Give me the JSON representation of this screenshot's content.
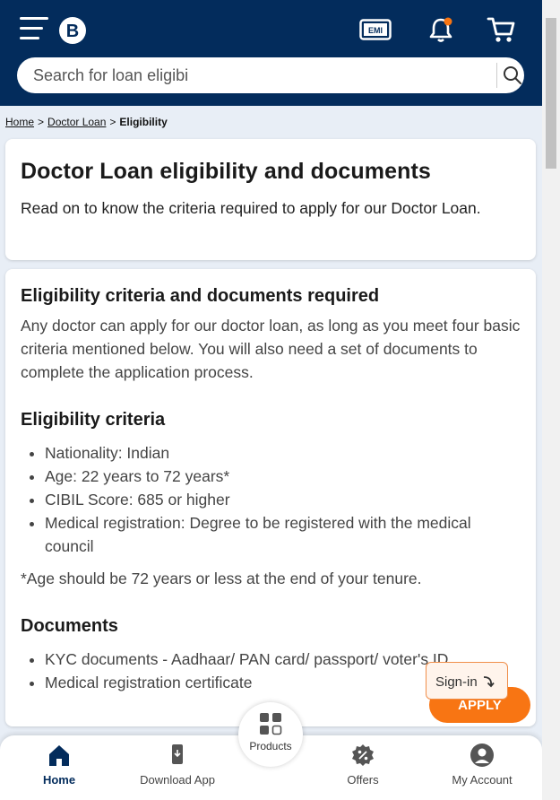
{
  "header": {
    "logo_letter": "B",
    "emi_label": "EMI",
    "notification_dot_color": "#f87513"
  },
  "search": {
    "placeholder": "Search for loan eligibi"
  },
  "breadcrumb": {
    "home": "Home",
    "doctor_loan": "Doctor Loan",
    "current": "Eligibility",
    "separator": ">"
  },
  "intro_card": {
    "title": "Doctor Loan eligibility and documents",
    "text": "Read on to know the criteria required to apply for our Doctor Loan."
  },
  "content": {
    "heading": "Eligibility criteria and documents required",
    "text": "Any doctor can apply for our doctor loan, as long as you meet four basic criteria mentioned below. You will also need a set of documents to complete the application process.",
    "criteria_heading": "Eligibility criteria",
    "criteria": [
      "Nationality: Indian",
      "Age: 22 years to 72 years*",
      "CIBIL Score: 685 or higher",
      "Medical registration: Degree to be registered with the medical council"
    ],
    "footnote": "*Age should be 72 years or less at the end of your tenure.",
    "documents_heading": "Documents",
    "documents": [
      "KYC documents - Aadhaar/ PAN card/ passport/ voter's ID",
      "Medical registration certificate"
    ]
  },
  "cta": {
    "signin": "Sign-in",
    "apply": "APPLY",
    "apply_color": "#f87513"
  },
  "bottom_nav": {
    "home": "Home",
    "download": "Download App",
    "products": "Products",
    "offers": "Offers",
    "account": "My Account"
  },
  "colors": {
    "brand_navy": "#032c5c",
    "accent_orange": "#f87513"
  }
}
